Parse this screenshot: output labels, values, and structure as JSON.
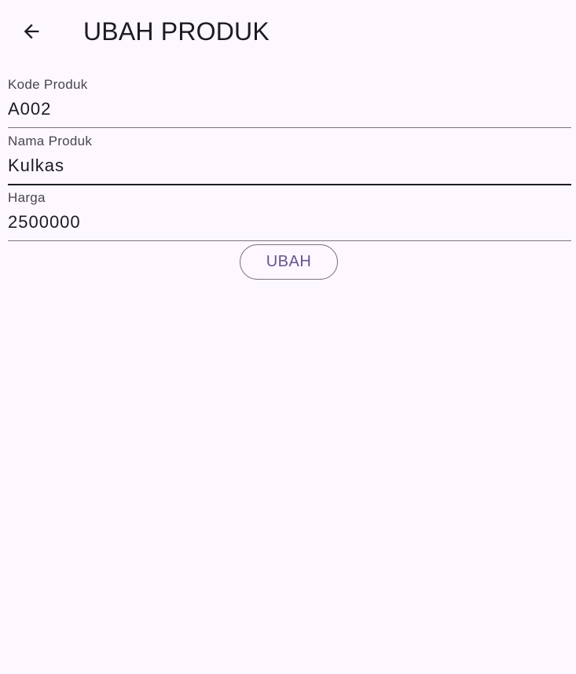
{
  "appbar": {
    "title": "UBAH PRODUK",
    "back_icon": "arrow-back-icon"
  },
  "form": {
    "fields": [
      {
        "label": "Kode Produk",
        "value": "A002",
        "focused": false
      },
      {
        "label": "Nama Produk",
        "value": "Kulkas",
        "focused": true
      },
      {
        "label": "Harga",
        "value": "2500000",
        "focused": false
      }
    ],
    "submit_label": "UBAH"
  },
  "colors": {
    "background": "#fdf7ff",
    "text": "#1d1b20",
    "label": "#49454f",
    "underline": "#79747e",
    "accent": "#65558f"
  }
}
